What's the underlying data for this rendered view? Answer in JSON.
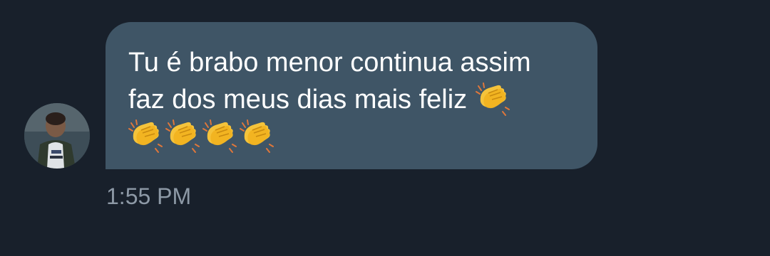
{
  "conversation": {
    "message": {
      "line1": "Tu é brabo menor continua assim",
      "line2": "faz dos meus dias mais feliz",
      "emoji_inline": "clapping-hands-icon",
      "emoji_row": [
        "clapping-hands-icon",
        "clapping-hands-icon",
        "clapping-hands-icon",
        "clapping-hands-icon"
      ],
      "timestamp": "1:55 PM"
    }
  },
  "colors": {
    "background": "#18202b",
    "bubble": "#3f5566",
    "message_text": "#ffffff",
    "timestamp_text": "#8d99a6",
    "clap_emoji": "#f5c33b"
  }
}
